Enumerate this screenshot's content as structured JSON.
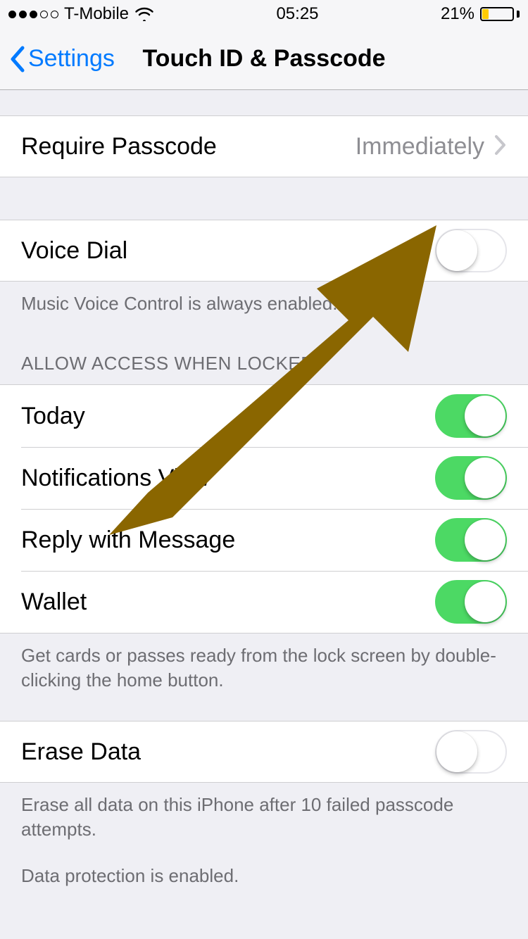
{
  "status_bar": {
    "carrier": "T-Mobile",
    "time": "05:25",
    "battery_percent": "21%",
    "signal_filled": 3,
    "signal_total": 5
  },
  "nav": {
    "back_label": "Settings",
    "title": "Touch ID & Passcode"
  },
  "require_passcode": {
    "label": "Require Passcode",
    "value": "Immediately"
  },
  "voice_dial": {
    "label": "Voice Dial",
    "enabled": false,
    "footer": "Music Voice Control is always enabled."
  },
  "allow_access": {
    "header": "ALLOW ACCESS WHEN LOCKED:",
    "items": [
      {
        "label": "Today",
        "enabled": true
      },
      {
        "label": "Notifications View",
        "enabled": true
      },
      {
        "label": "Reply with Message",
        "enabled": true
      },
      {
        "label": "Wallet",
        "enabled": true
      }
    ],
    "footer": "Get cards or passes ready from the lock screen by double-clicking the home button."
  },
  "erase_data": {
    "label": "Erase Data",
    "enabled": false,
    "footer1": "Erase all data on this iPhone after 10 failed passcode attempts.",
    "footer2": "Data protection is enabled."
  },
  "annotation": {
    "color": "#8a6600"
  }
}
